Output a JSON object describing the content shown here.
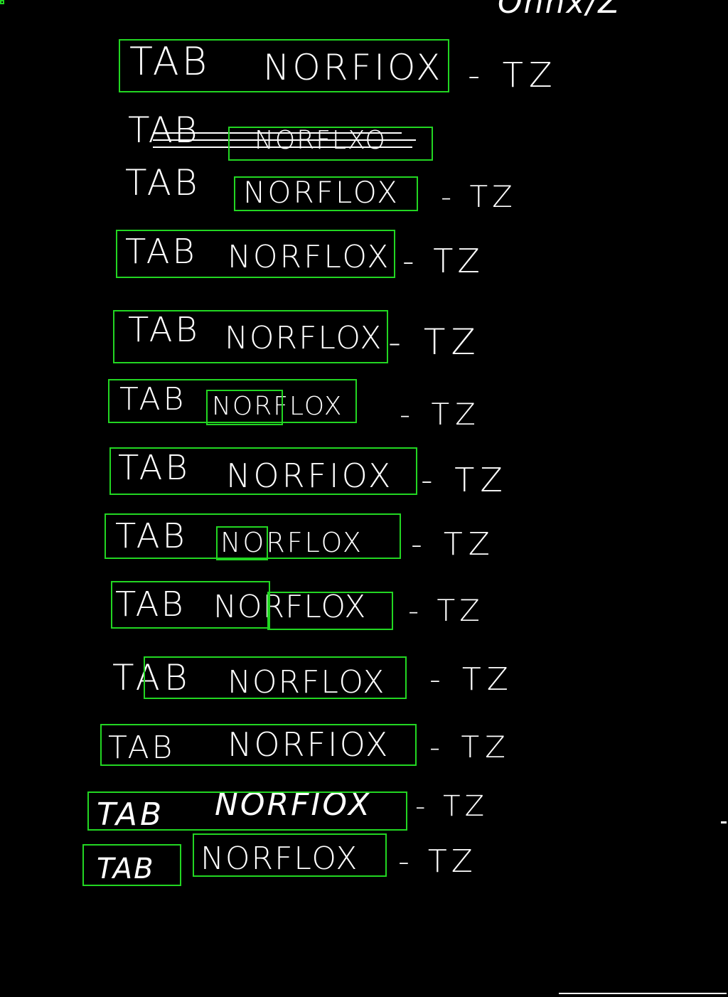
{
  "colors": {
    "background": "#000000",
    "ink": "#ffffff",
    "box": "#22d622"
  },
  "header": {
    "text": "Onnx/Z"
  },
  "lines": [
    {
      "tab": "TAB",
      "drug": "NORFIOX",
      "suffix": "- TZ"
    },
    {
      "tab": "TAB",
      "drug": "NORFLXO",
      "suffix": ""
    },
    {
      "tab": "TAB",
      "drug": "NORFLOX",
      "suffix": "- TZ"
    },
    {
      "tab": "TAB",
      "drug": "NORFLOX",
      "suffix": "- TZ"
    },
    {
      "tab": "TAB",
      "drug": "NORFLOX",
      "suffix": "- TZ"
    },
    {
      "tab": "TAB",
      "drug": "NORFLOX",
      "suffix": "- TZ"
    },
    {
      "tab": "TAB",
      "drug": "NORFIOX",
      "suffix": "- TZ"
    },
    {
      "tab": "TAB",
      "drug": "NORFLOX",
      "suffix": "- TZ"
    },
    {
      "tab": "TAB",
      "drug": "NORFLOX",
      "suffix": "- TZ"
    },
    {
      "tab": "TAB",
      "drug": "NORFLOX",
      "suffix": "- TZ"
    },
    {
      "tab": "TAB",
      "drug": "NORFIOX",
      "suffix": "- TZ"
    },
    {
      "tab": "TAB",
      "drug": "NORFIOX",
      "suffix": "- TZ"
    },
    {
      "tab": "TAB",
      "drug": "NORFLOX",
      "suffix": "- TZ"
    }
  ]
}
